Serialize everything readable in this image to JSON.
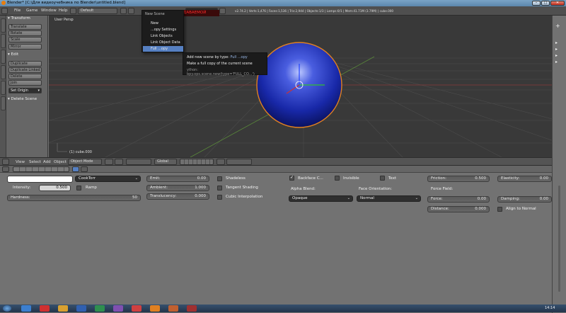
{
  "window": {
    "title": "Blender* [C:\\Для видеоучебника по Blender\\untitled.blend]"
  },
  "menubar": {
    "items": [
      "File",
      "Game",
      "Window",
      "Help"
    ],
    "layout": "Default",
    "scene_label": "New Scene",
    "stats": "v2.74.2 | Verts:1,476 | Faces:1,536 | Tris:2,944 | Objects:1/3 | Lamps:0/1 | Mem:41.71M (3.79M) | cube.000"
  },
  "caption_overlay": "ТИП СОЗДАВАЕМОЙ СЦЕНЫ",
  "dropdown": {
    "title": "New Scene",
    "items": [
      "New",
      "...opy Settings",
      "Link Objects",
      "Link Object Data",
      "Full ...opy"
    ],
    "selected_index": 4
  },
  "tooltip": {
    "line1_prefix": "Add new scene by type:",
    "line1_value": "Full ...opy",
    "line2": "Make a full copy of the current scene",
    "line3": "ython: bpy.ops.scene.new(type='FULL_CO...')"
  },
  "toolshelf": {
    "transform_header": "Transform",
    "transform_buttons": [
      "Translate",
      "Rotate",
      "Scale",
      "Mirror"
    ],
    "edit_header": "Edit",
    "edit_buttons": [
      "Duplicate",
      "Duplicate Linked",
      "Delete",
      "Join"
    ],
    "set_origin": "Set Origin",
    "delete_scene": "Delete Scene"
  },
  "viewport": {
    "view_name": "User Persp",
    "object_label": "(1) cube.000",
    "colors": {
      "sphere": "#2030b0",
      "outline": "#e08020",
      "grid": "#4a4a4a",
      "x_axis": "#b03030",
      "y_axis": "#60a030"
    }
  },
  "viewport_header": {
    "menus": [
      "View",
      "Select",
      "Add",
      "Object"
    ],
    "mode": "Object Mode",
    "orientation": "Global"
  },
  "material": {
    "shader": "CookTorr",
    "intensity_label": "Intensity:",
    "intensity": "0.500",
    "ramp": "Ramp",
    "hardness_label": "Hardness:",
    "hardness": "50",
    "emit_label": "Emit:",
    "emit": "0.00",
    "ambient_label": "Ambient:",
    "ambient": "1.000",
    "translucency_label": "Translucency:",
    "translucency": "0.000",
    "shadeless": "Shadeless",
    "tangent_shading": "Tangent Shading",
    "cubic_interpolation": "Cubic Interpolation",
    "backface": "Backface C...",
    "invisible": "Invisible",
    "text": "Text",
    "alpha_blend_label": "Alpha Blend:",
    "alpha_blend": "Opaque",
    "face_orientation_label": "Face Orientation:",
    "face_orientation": "Normal"
  },
  "physics": {
    "friction_label": "Friction:",
    "friction": "0.500",
    "elasticity_label": "Elasticity:",
    "elasticity": "0.00",
    "force_field": "Force Field:",
    "force_label": "Force:",
    "force": "0.00",
    "damping_label": "Damping:",
    "damping": "0.00",
    "distance_label": "Distance:",
    "distance": "0.000",
    "align_to_normal": "Align to Normal"
  },
  "taskbar": {
    "clock": "14:14"
  }
}
